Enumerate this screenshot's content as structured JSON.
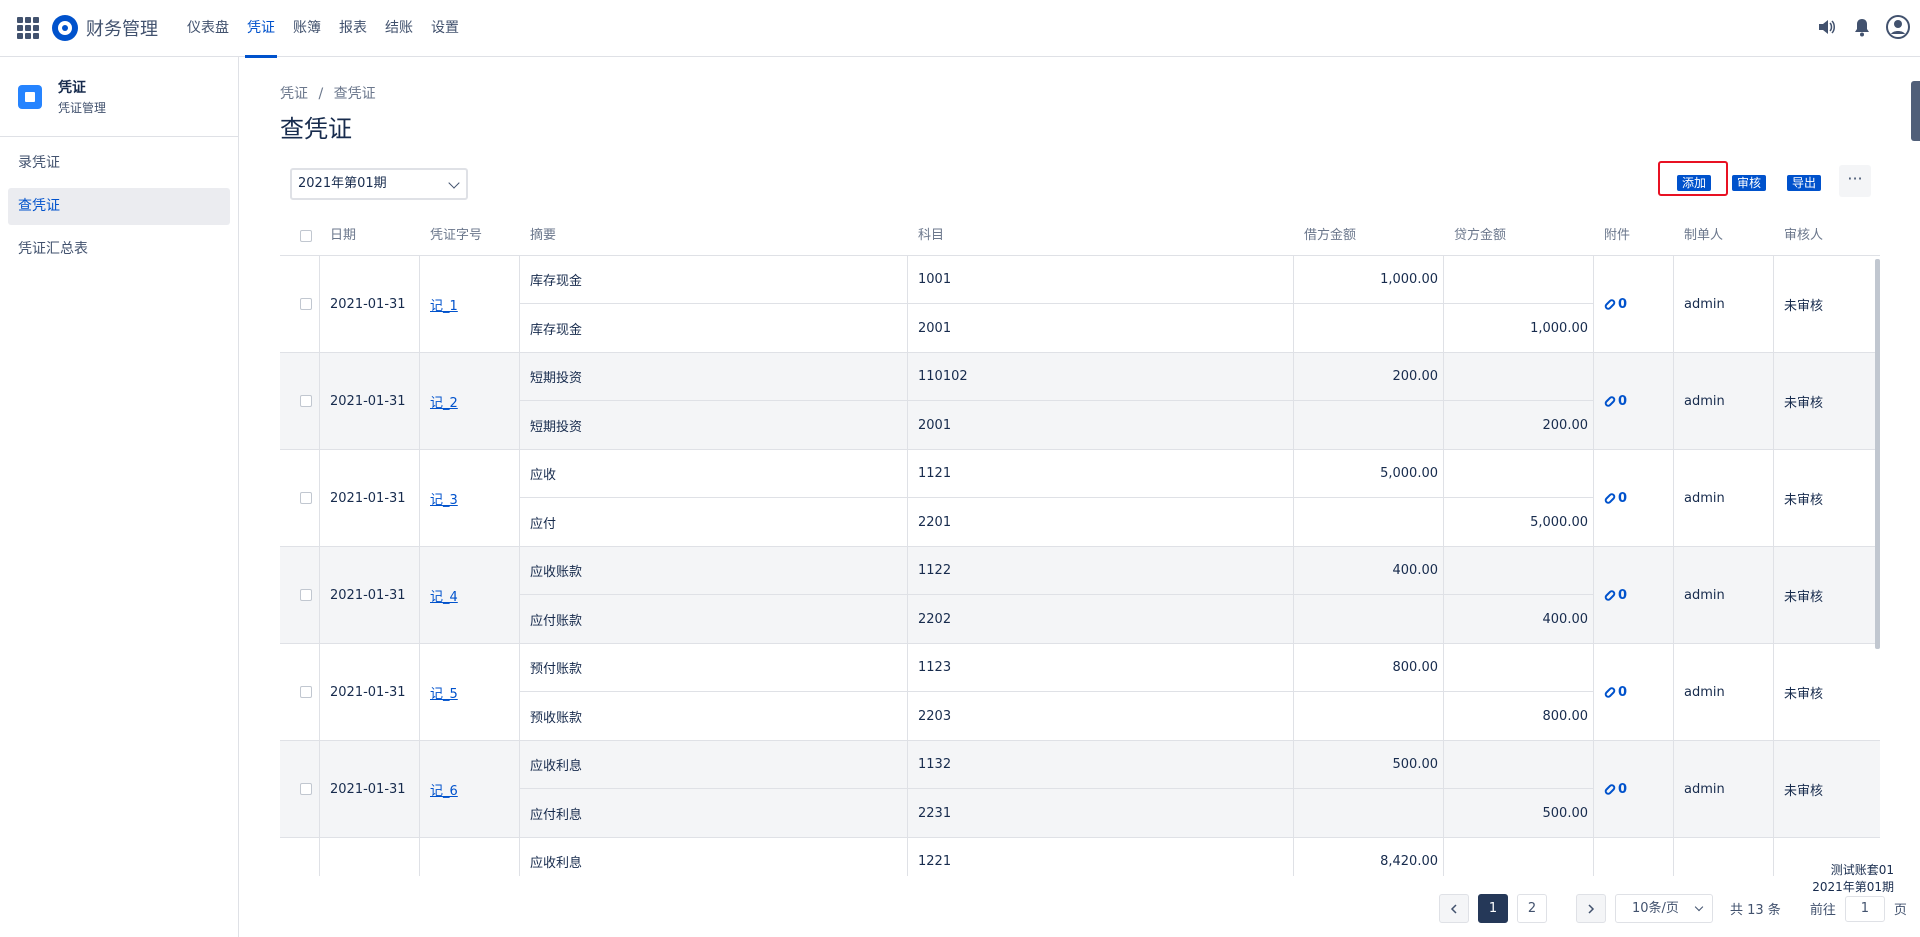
{
  "app": {
    "name": "财务管理"
  },
  "nav": [
    "仪表盘",
    "凭证",
    "账簿",
    "报表",
    "结账",
    "设置"
  ],
  "sidebar": {
    "title": "凭证",
    "subtitle": "凭证管理",
    "items": [
      "录凭证",
      "查凭证",
      "凭证汇总表"
    ]
  },
  "breadcrumb": [
    "凭证",
    "/",
    "查凭证"
  ],
  "page_title": "查凭证",
  "toolbar": {
    "period": "2021年第01期",
    "add": "添加",
    "audit": "审核",
    "export": "导出",
    "more": "···"
  },
  "table": {
    "headers": [
      "日期",
      "凭证字号",
      "摘要",
      "科目",
      "借方金额",
      "贷方金额",
      "附件",
      "制单人",
      "审核人"
    ],
    "rows": [
      {
        "date": "2021-01-31",
        "no": "记_1",
        "l1": {
          "summary": "库存现金",
          "account": "1001",
          "debit": "1,000.00",
          "credit": ""
        },
        "l2": {
          "summary": "库存现金",
          "account": "2001",
          "debit": "",
          "credit": "1,000.00"
        },
        "attach": "0",
        "maker": "admin",
        "auditor": "未审核"
      },
      {
        "date": "2021-01-31",
        "no": "记_2",
        "l1": {
          "summary": "短期投资",
          "account": "110102",
          "debit": "200.00",
          "credit": ""
        },
        "l2": {
          "summary": "短期投资",
          "account": "2001",
          "debit": "",
          "credit": "200.00"
        },
        "attach": "0",
        "maker": "admin",
        "auditor": "未审核"
      },
      {
        "date": "2021-01-31",
        "no": "记_3",
        "l1": {
          "summary": "应收",
          "account": "1121",
          "debit": "5,000.00",
          "credit": ""
        },
        "l2": {
          "summary": "应付",
          "account": "2201",
          "debit": "",
          "credit": "5,000.00"
        },
        "attach": "0",
        "maker": "admin",
        "auditor": "未审核"
      },
      {
        "date": "2021-01-31",
        "no": "记_4",
        "l1": {
          "summary": "应收账款",
          "account": "1122",
          "debit": "400.00",
          "credit": ""
        },
        "l2": {
          "summary": "应付账款",
          "account": "2202",
          "debit": "",
          "credit": "400.00"
        },
        "attach": "0",
        "maker": "admin",
        "auditor": "未审核"
      },
      {
        "date": "2021-01-31",
        "no": "记_5",
        "l1": {
          "summary": "预付账款",
          "account": "1123",
          "debit": "800.00",
          "credit": ""
        },
        "l2": {
          "summary": "预收账款",
          "account": "2203",
          "debit": "",
          "credit": "800.00"
        },
        "attach": "0",
        "maker": "admin",
        "auditor": "未审核"
      },
      {
        "date": "2021-01-31",
        "no": "记_6",
        "l1": {
          "summary": "应收利息",
          "account": "1132",
          "debit": "500.00",
          "credit": ""
        },
        "l2": {
          "summary": "应付利息",
          "account": "2231",
          "debit": "",
          "credit": "500.00"
        },
        "attach": "0",
        "maker": "admin",
        "auditor": "未审核"
      },
      {
        "date": "",
        "no": "",
        "l1": {
          "summary": "应收利息",
          "account": "1221",
          "debit": "8,420.00",
          "credit": ""
        },
        "l2": {
          "summary": "",
          "account": "",
          "debit": "",
          "credit": ""
        },
        "attach": "",
        "maker": "",
        "auditor": ""
      }
    ]
  },
  "pager": {
    "pages": [
      "1",
      "2"
    ],
    "size": "10条/页",
    "total": "共 13 条",
    "goto_label": "前往",
    "goto_value": "1",
    "page_unit": "页"
  },
  "corner": {
    "book": "测试账套01",
    "period": "2021年第01期"
  }
}
